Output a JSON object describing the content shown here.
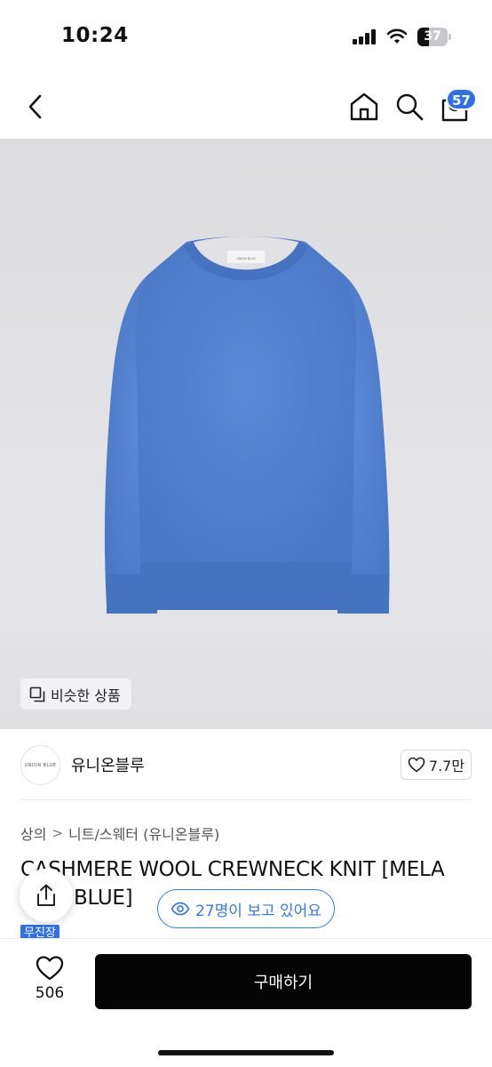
{
  "status_bar": {
    "time": "10:24",
    "battery": "37",
    "battery_level": 0.37
  },
  "header": {
    "cart_count": "57"
  },
  "product_image": {
    "sweater_color": "#4f7fd1",
    "label_text": "UNION BLUE"
  },
  "similar_button": {
    "label": "비슷한 상품"
  },
  "brand": {
    "logo_text": "UNION BLUE",
    "name": "유니온블루",
    "likes": "7.7만"
  },
  "breadcrumb": {
    "category": "상의",
    "separator": ">",
    "subcategory": "니트/스웨터 (유니온블루)"
  },
  "product": {
    "title_visible": "CASHMERE WOOL CREWNECK KNIT [MELA",
    "title_line2_visible": "BLUE]",
    "tag": "무진장"
  },
  "viewers": {
    "text": "27명이 보고 있어요"
  },
  "bottom_bar": {
    "wish_count": "506",
    "buy_label": "구매하기"
  },
  "colors": {
    "accent": "#2f6fe8",
    "buy_button": "#050505"
  }
}
